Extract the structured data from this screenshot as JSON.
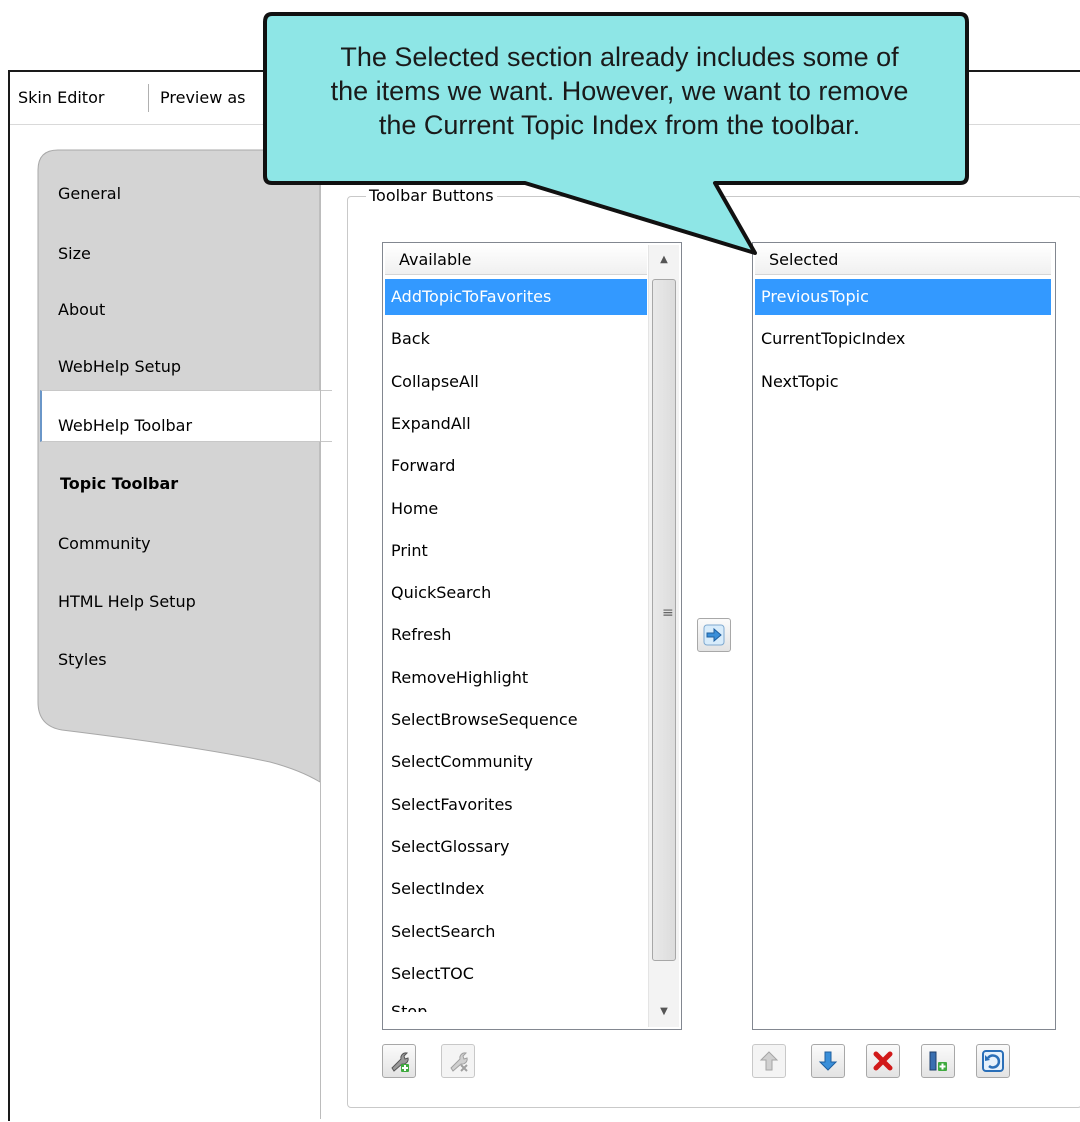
{
  "topbar": {
    "items": [
      {
        "label": "Skin Editor"
      },
      {
        "label": "Preview as"
      }
    ]
  },
  "sidebar": {
    "items": [
      {
        "label": "General"
      },
      {
        "label": "Size"
      },
      {
        "label": "About"
      },
      {
        "label": "WebHelp Setup"
      },
      {
        "label": "WebHelp Toolbar"
      },
      {
        "label": "Topic Toolbar",
        "active": true
      },
      {
        "label": "Community"
      },
      {
        "label": "HTML Help Setup"
      },
      {
        "label": "Styles"
      }
    ]
  },
  "toolbar_buttons": {
    "group_title": "Toolbar Buttons",
    "available": {
      "header": "Available",
      "items": [
        "AddTopicToFavorites",
        "Back",
        "CollapseAll",
        "ExpandAll",
        "Forward",
        "Home",
        "Print",
        "QuickSearch",
        "Refresh",
        "RemoveHighlight",
        "SelectBrowseSequence",
        "SelectCommunity",
        "SelectFavorites",
        "SelectGlossary",
        "SelectIndex",
        "SelectSearch",
        "SelectTOC",
        "Stop"
      ],
      "selected_item": "AddTopicToFavorites"
    },
    "selected": {
      "header": "Selected",
      "items": [
        "PreviousTopic",
        "CurrentTopicIndex",
        "NextTopic"
      ],
      "selected_item": "PreviousTopic"
    }
  },
  "callout": {
    "text_lines": [
      "The Selected section already includes some of",
      "the items we want. However, we want to remove",
      "the Current Topic Index from the toolbar."
    ]
  },
  "colors": {
    "selection": "#3399ff",
    "callout_fill": "#8ee6e6",
    "callout_border": "#111111",
    "sidebar_tab": "#d4d4d4"
  }
}
